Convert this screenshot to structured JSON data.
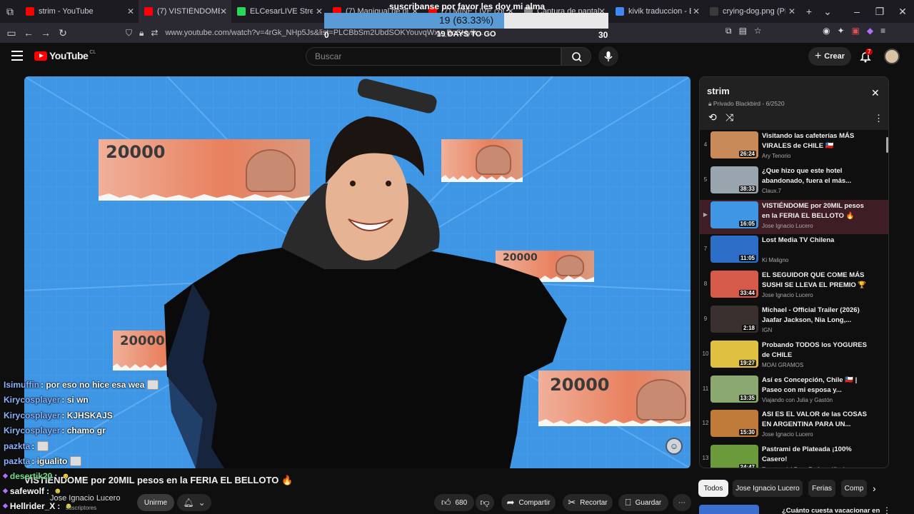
{
  "browser": {
    "tabs": [
      {
        "label": "strim - YouTube",
        "fav": "#ff0000",
        "width": 166
      },
      {
        "label": "(7) VISTIÉNDOME por 20MIL",
        "fav": "#ff0000",
        "width": 130,
        "active": true
      },
      {
        "label": "ELCesarLIVE Stream - Watch",
        "fav": "#2bd65a",
        "width": 134
      },
      {
        "label": "(7) Manigual de planchado",
        "fav": "#ff0000",
        "width": 134
      },
      {
        "label": "(7) MINE LIVE con Amigos",
        "fav": "#ff0000",
        "width": 134
      },
      {
        "label": "Captura de pantalla por Lis",
        "fav": "#8a8a8a",
        "width": 128
      },
      {
        "label": "kivik traduccion - Buscar con",
        "fav": "#4285f4",
        "width": 132
      },
      {
        "label": "crying-dog.png (PNG Imagen, 3",
        "fav": "#3a3a3a",
        "width": 134
      }
    ],
    "url": "www.youtube.com/watch?v=4rGk_NHp5Js&list=PLCBbSm2UbdSOKYouvqWxy_BoSHyik..."
  },
  "goal": {
    "title": "suscribanse por favor les doy mi alma",
    "progress_label": "19 (63.33%)",
    "progress": 0.6333,
    "min": "0",
    "days_left": "19 DAYS TO GO",
    "max": "30"
  },
  "youtube": {
    "logo": "YouTube",
    "country": "CL",
    "search_placeholder": "Buscar",
    "create_label": "Crear",
    "notif_count": "7"
  },
  "video": {
    "title": "VISTIÉNDOME por 20MIL pesos en la FERIA EL BELLOTO 🔥",
    "channel": "Jose Ignacio Lucero",
    "subs_label": "suscriptores",
    "join_label": "Unirme",
    "banknote_value": "20000",
    "actions": {
      "likes": "680",
      "share": "Compartir",
      "clip": "Recortar",
      "save": "Guardar"
    }
  },
  "chat": [
    {
      "user": "Isimuffin",
      "msg": ": por eso no hice esa wea",
      "emote": true
    },
    {
      "user": "Kirycosplayer",
      "msg": ": si wn",
      "emote": false
    },
    {
      "user": "Kirycosplayer",
      "msg": ": KJHSKAJS",
      "emote": false
    },
    {
      "user": "Kirycosplayer",
      "msg": ": chamo gr",
      "emote": false
    },
    {
      "user": "pazkta",
      "msg": ":",
      "emote": true
    },
    {
      "user": "pazkta",
      "msg": ": igualito",
      "emote": true
    }
  ],
  "chat_lower": [
    {
      "user": "desertik20",
      "msg": ":",
      "color": "#6fdc8c"
    },
    {
      "user": "safewolf",
      "msg": ":",
      "color": "#ffffff"
    },
    {
      "user": "Hellrider_X",
      "msg": ":",
      "color": "#ffffff"
    }
  ],
  "playlist": {
    "title": "strim",
    "subtitle": "Privado Blackbird - 6/2520",
    "items": [
      {
        "index": "4",
        "title": "Visitando las cafeterías MÁS VIRALES de CHILE 🇨🇱",
        "channel": "Ary Tenorio",
        "duration": "26:24",
        "thumb": "#c98a5a"
      },
      {
        "index": "5",
        "title": "¿Que hizo que este hotel abandonado, fuera el más...",
        "channel": "Claux.7",
        "duration": "38:33",
        "thumb": "#9aa4ae"
      },
      {
        "index": "▶",
        "title": "VISTIÉNDOME por 20MIL pesos en la FERIA EL BELLOTO 🔥",
        "channel": "Jose Ignacio Lucero",
        "duration": "16:05",
        "thumb": "#3e96e4",
        "active": true
      },
      {
        "index": "7",
        "title": "Lost Media TV Chilena",
        "channel": "Ki Maligno",
        "duration": "11:05",
        "thumb": "#2d6ec9"
      },
      {
        "index": "8",
        "title": "EL SEGUIDOR QUE COME MÁS SUSHI SE LLEVA EL PREMIO 🏆",
        "channel": "Jose Ignacio Lucero",
        "duration": "33:44",
        "thumb": "#d65a4a"
      },
      {
        "index": "9",
        "title": "Michael - Official Trailer (2026) Jaafar Jackson, Nia Long,...",
        "channel": "IGN",
        "duration": "2:18",
        "thumb": "#3a3030"
      },
      {
        "index": "10",
        "title": "Probando TODOS los YOGURES de CHILE",
        "channel": "MOAI GRAMOS",
        "duration": "19:27",
        "thumb": "#e0c040"
      },
      {
        "index": "11",
        "title": "Así es Concepción, Chile 🇨🇱 | Paseo con mi esposa y...",
        "channel": "Viajando con Julia y Gastón",
        "duration": "13:35",
        "thumb": "#8aa870"
      },
      {
        "index": "12",
        "title": "ASI ES EL VALOR de las COSAS EN ARGENTINA PARA UN...",
        "channel": "Jose Ignacio Lucero",
        "duration": "15:30",
        "thumb": "#c07a3a"
      },
      {
        "index": "13",
        "title": "Pastrami de Plateada ¡100% Casero!",
        "channel": "Recetas del Sur x Profesor Kleeber",
        "duration": "24:47",
        "thumb": "#6a9a3a"
      }
    ]
  },
  "chips": [
    "Todos",
    "Jose Ignacio Lucero",
    "Ferias",
    "Comp"
  ],
  "next_video_title": "¿Cuánto cuesta vacacionar en"
}
